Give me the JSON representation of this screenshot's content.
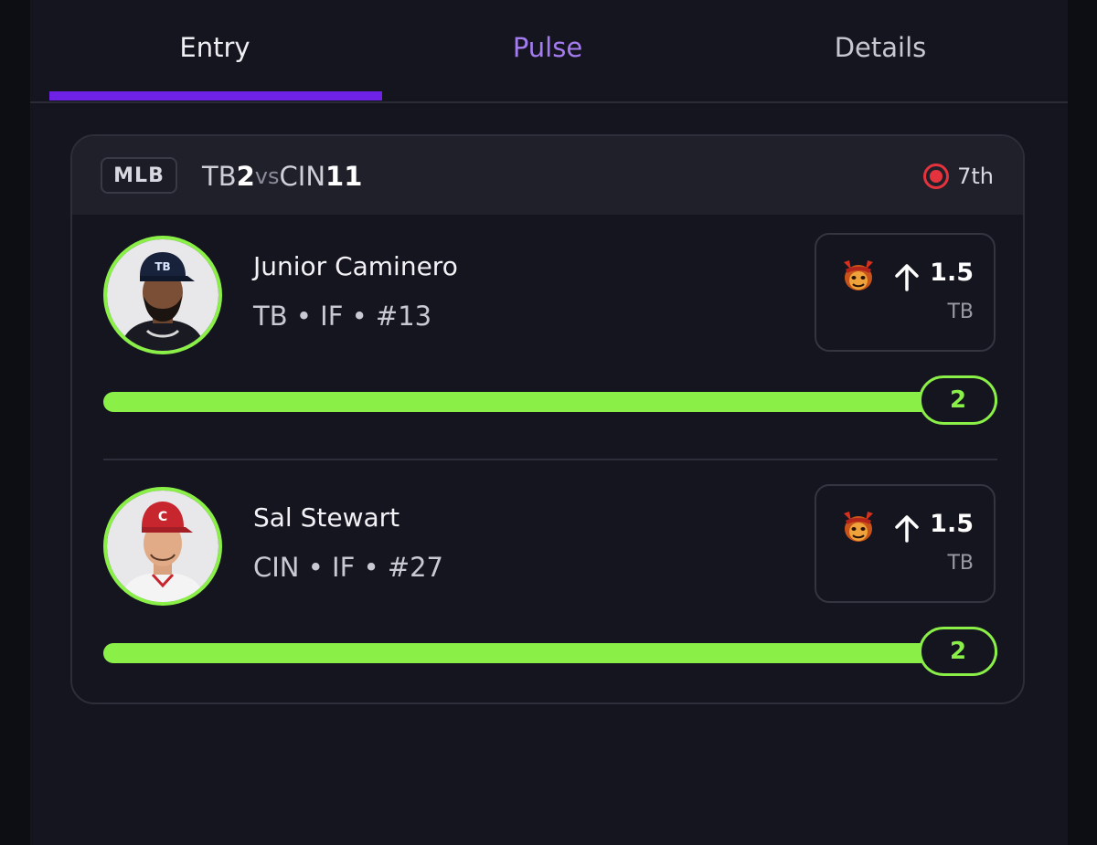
{
  "tabs": {
    "entry": "Entry",
    "pulse": "Pulse",
    "details": "Details",
    "active": "Entry"
  },
  "game": {
    "league": "MLB",
    "away_team": "TB",
    "away_score": "2",
    "vs": "vs",
    "home_team": "CIN",
    "home_score": "11",
    "inning": "7th",
    "live_icon": "live-record-icon"
  },
  "players": [
    {
      "name": "Junior Caminero",
      "meta": "TB • IF • #13",
      "avatar_icon": "player-avatar",
      "pick_icon": "demon-icon",
      "direction_icon": "arrow-up-icon",
      "line": "1.5",
      "line_team": "TB",
      "progress_value": "2",
      "progress_fraction": 1.0
    },
    {
      "name": "Sal Stewart",
      "meta": "CIN • IF • #27",
      "avatar_icon": "player-avatar",
      "pick_icon": "demon-icon",
      "direction_icon": "arrow-up-icon",
      "line": "1.5",
      "line_team": "TB",
      "progress_value": "2",
      "progress_fraction": 1.0
    }
  ],
  "colors": {
    "accent_purple": "#6d22e6",
    "pulse_text": "#a57cf0",
    "progress_green": "#8af048",
    "live_red": "#e5333d"
  }
}
